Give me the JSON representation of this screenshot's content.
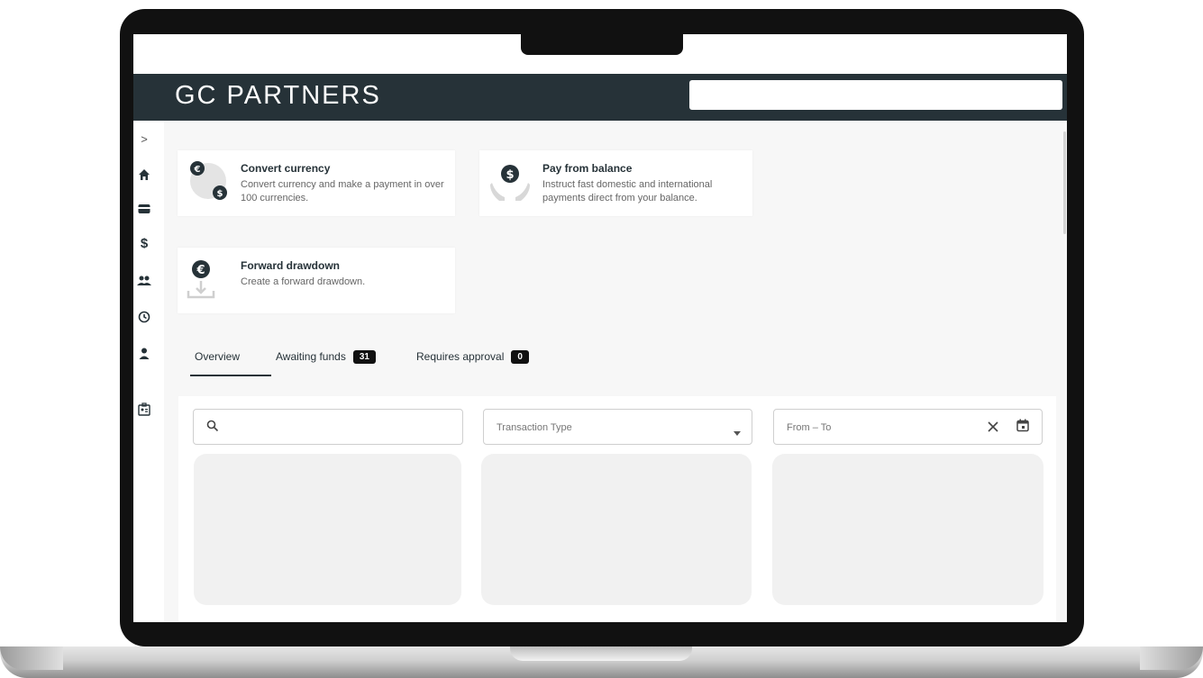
{
  "header": {
    "brand": "GC PARTNERS",
    "search_placeholder": ""
  },
  "sidebar": {
    "toggle_glyph": ">",
    "items": [
      {
        "icon": "home-icon"
      },
      {
        "icon": "card-icon"
      },
      {
        "icon": "dollar-icon"
      },
      {
        "icon": "people-icon"
      },
      {
        "icon": "history-icon"
      },
      {
        "icon": "person-icon"
      },
      {
        "icon": "id-badge-icon"
      }
    ]
  },
  "actions": [
    {
      "title": "Convert currency",
      "description": "Convert currency and make a payment in over 100 currencies.",
      "icon": "convert-currency-icon"
    },
    {
      "title": "Pay from balance",
      "description": "Instruct fast domestic and international payments direct from your balance.",
      "icon": "pay-from-balance-icon"
    },
    {
      "title": "Forward drawdown",
      "description": "Create a forward drawdown.",
      "icon": "forward-drawdown-icon"
    }
  ],
  "tabs": [
    {
      "label": "Overview",
      "active": true
    },
    {
      "label": "Awaiting funds",
      "count": "31"
    },
    {
      "label": "Requires approval",
      "count": "0"
    }
  ],
  "filters": {
    "search_placeholder": "",
    "transaction_type_placeholder": "Transaction Type",
    "date_range_placeholder": "From – To"
  },
  "colors": {
    "header_bg": "#263238",
    "content_bg": "#f7f7f7",
    "skeleton": "#f1f1f1",
    "badge_bg": "#111111"
  }
}
